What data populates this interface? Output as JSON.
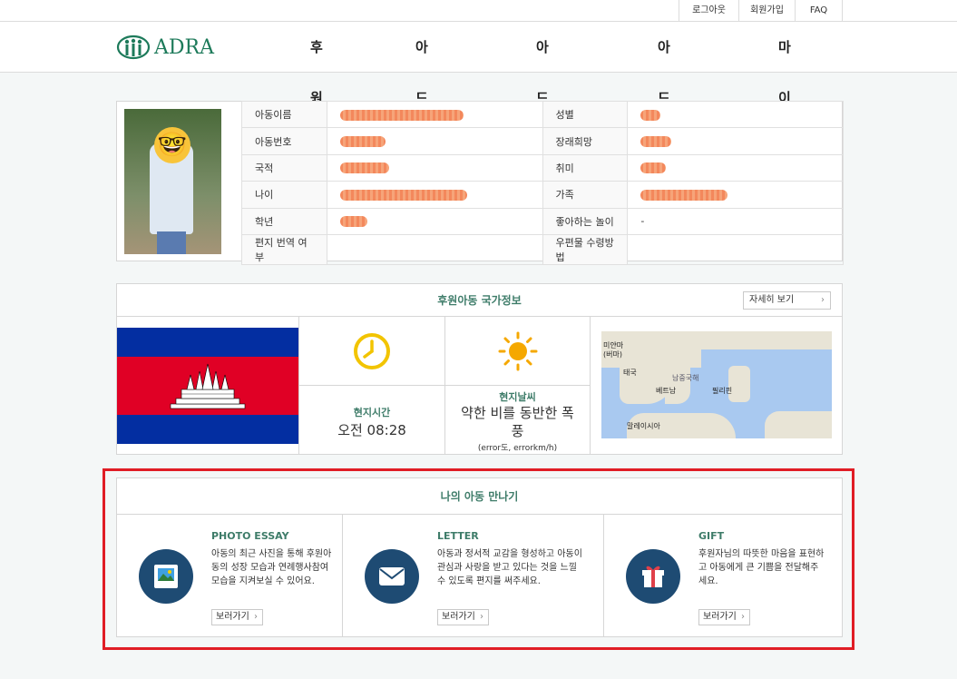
{
  "util": {
    "logout": "로그아웃",
    "signup": "회원가입",
    "faq": "FAQ"
  },
  "brand": {
    "name": "ADRA",
    "color": "#1d7a5a"
  },
  "nav": {
    "items": [
      "후원하기",
      "아드라 소개",
      "아드라 활동",
      "아드라 소식",
      "마이아드라"
    ]
  },
  "profile": {
    "labels_left": [
      "아동이름",
      "아동번호",
      "국적",
      "나이",
      "학년",
      "편지 번역 여부"
    ],
    "labels_right": [
      "성별",
      "장래희망",
      "취미",
      "가족",
      "좋아하는 놀이",
      "우편물 수령방법"
    ],
    "favorite_play_value": "-"
  },
  "country": {
    "title": "후원아동 국가정보",
    "detail_button": "자세히 보기",
    "time_label": "현지시간",
    "time_value": "오전 08:28",
    "weather_label": "현지날씨",
    "weather_value": "약한 비를 동반한 폭풍",
    "weather_detail": "(error도, errorkm/h)",
    "map_labels": [
      "미얀마 (버마)",
      "태국",
      "남중국해",
      "베트남",
      "필리핀",
      "말레이시아"
    ]
  },
  "meet": {
    "title": "나의 아동 만나기",
    "columns": [
      {
        "head": "PHOTO ESSAY",
        "desc": "아동의 최근 사진을 통해 후원아동의 성장 모습과 연례행사참여 모습을 지켜보실 수 있어요.",
        "button": "보러가기"
      },
      {
        "head": "LETTER",
        "desc": "아동과 정서적 교감을 형성하고 아동이 관심과 사랑을 받고 있다는 것을 느낄 수 있도록 편지를 써주세요.",
        "button": "보러가기"
      },
      {
        "head": "GIFT",
        "desc": "후원자님의 따뜻한 마음을 표현하고 아동에게 큰 기쁨을 전달해주세요.",
        "button": "보러가기"
      }
    ]
  }
}
